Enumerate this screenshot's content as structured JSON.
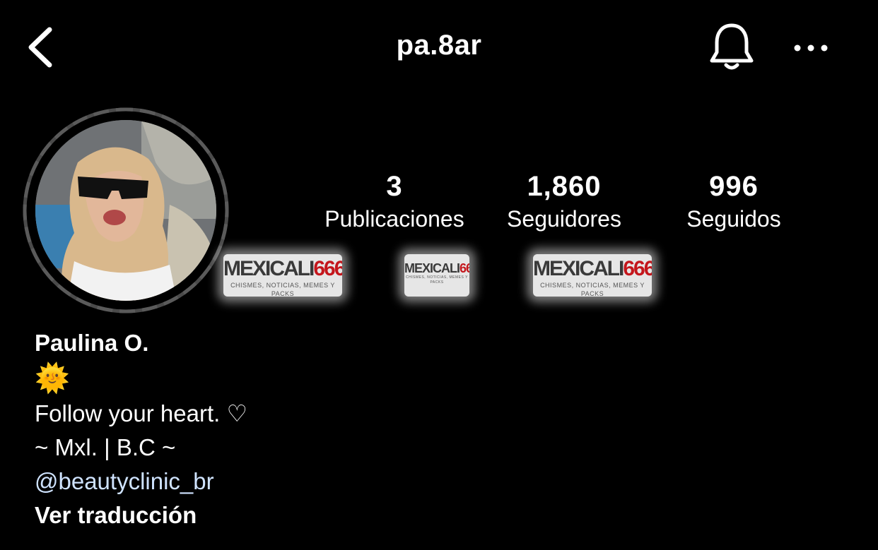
{
  "header": {
    "username": "pa.8ar",
    "back_icon": "chevron-left-icon",
    "bell_icon": "bell-icon",
    "more_icon": "ellipsis-icon"
  },
  "stats": [
    {
      "value": "3",
      "label": "Publicaciones"
    },
    {
      "value": "1,860",
      "label": "Seguidores"
    },
    {
      "value": "996",
      "label": "Seguidos"
    }
  ],
  "watermark": {
    "brand_a": "MEXICALI",
    "brand_b": "666",
    "subtitle": "CHISMES, NOTICIAS, MEMES Y PACKS"
  },
  "profile": {
    "name": "Paulina O.",
    "emoji": "🌞",
    "bio_line1": "Follow your heart. ♡",
    "bio_line2": "~ Mxl. | B.C ~",
    "mention": "@beautyclinic_br",
    "translate": "Ver traducción"
  },
  "colors": {
    "background": "#000000",
    "text": "#ffffff",
    "mention": "#cfe3ff",
    "watermark_red": "#c4161c"
  }
}
